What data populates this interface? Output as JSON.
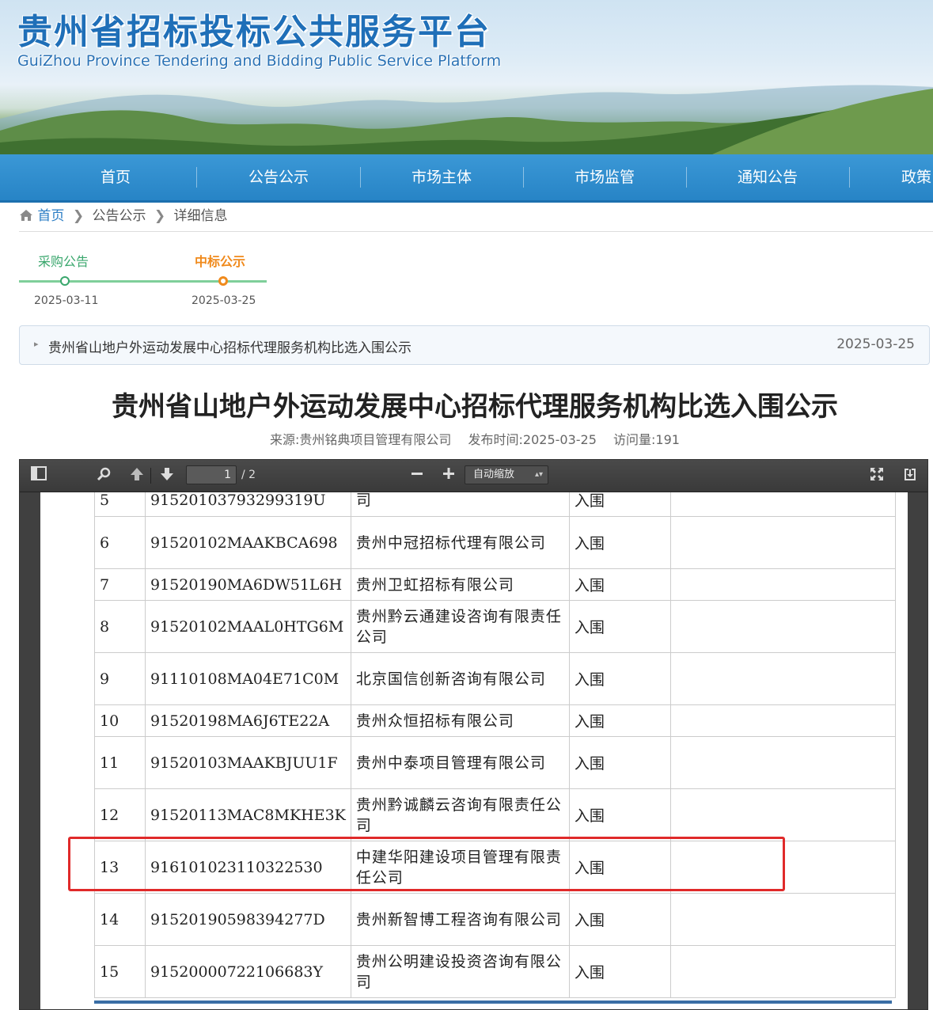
{
  "site": {
    "title_cn": "贵州省招标投标公共服务平台",
    "title_en": "GuiZhou Province Tendering and Bidding Public Service Platform"
  },
  "nav": [
    "首页",
    "公告公示",
    "市场主体",
    "市场监管",
    "通知公告",
    "政策"
  ],
  "breadcrumb": {
    "home": "首页",
    "section": "公告公示",
    "current": "详细信息"
  },
  "timeline": [
    {
      "label": "采购公告",
      "date": "2025-03-11",
      "color": "#3aa76d"
    },
    {
      "label": "中标公示",
      "date": "2025-03-25",
      "color": "#f08a1c"
    }
  ],
  "notice": {
    "title": "贵州省山地户外运动发展中心招标代理服务机构比选入围公示",
    "date": "2025-03-25"
  },
  "article": {
    "title": "贵州省山地户外运动发展中心招标代理服务机构比选入围公示",
    "source": "来源:贵州铭典项目管理有限公司",
    "publish_time": "发布时间:2025-03-25",
    "visits": "访问量:191"
  },
  "pdf": {
    "page_current": "1",
    "page_total": "/ 2",
    "zoom": "自动缩放"
  },
  "table": {
    "rows": [
      {
        "no": "5",
        "code": "91520103793299319U",
        "name": "司",
        "result": "入围",
        "remark": ""
      },
      {
        "no": "6",
        "code": "91520102MAAKBCA698",
        "name": "贵州中冠招标代理有限公司",
        "result": "入围",
        "remark": ""
      },
      {
        "no": "7",
        "code": "91520190MA6DW51L6H",
        "name": "贵州卫虹招标有限公司",
        "result": "入围",
        "remark": ""
      },
      {
        "no": "8",
        "code": "91520102MAAL0HTG6M",
        "name": "贵州黔云通建设咨询有限责任公司",
        "result": "入围",
        "remark": ""
      },
      {
        "no": "9",
        "code": "91110108MA04E71C0M",
        "name": "北京国信创新咨询有限公司",
        "result": "入围",
        "remark": ""
      },
      {
        "no": "10",
        "code": "91520198MA6J6TE22A",
        "name": "贵州众恒招标有限公司",
        "result": "入围",
        "remark": ""
      },
      {
        "no": "11",
        "code": "91520103MAAKBJUU1F",
        "name": "贵州中泰项目管理有限公司",
        "result": "入围",
        "remark": ""
      },
      {
        "no": "12",
        "code": "91520113MAC8MKHE3K",
        "name": "贵州黔诚麟云咨询有限责任公司",
        "result": "入围",
        "remark": ""
      },
      {
        "no": "13",
        "code": "916101023110322530",
        "name": "中建华阳建设项目管理有限责任公司",
        "result": "入围",
        "remark": ""
      },
      {
        "no": "14",
        "code": "91520190598394277D",
        "name": "贵州新智博工程咨询有限公司",
        "result": "入围",
        "remark": ""
      },
      {
        "no": "15",
        "code": "91520000722106683Y",
        "name": "贵州公明建设投资咨询有限公司",
        "result": "入围",
        "remark": ""
      }
    ],
    "highlighted_row": "13",
    "highlight_color": "#e02a2a"
  }
}
